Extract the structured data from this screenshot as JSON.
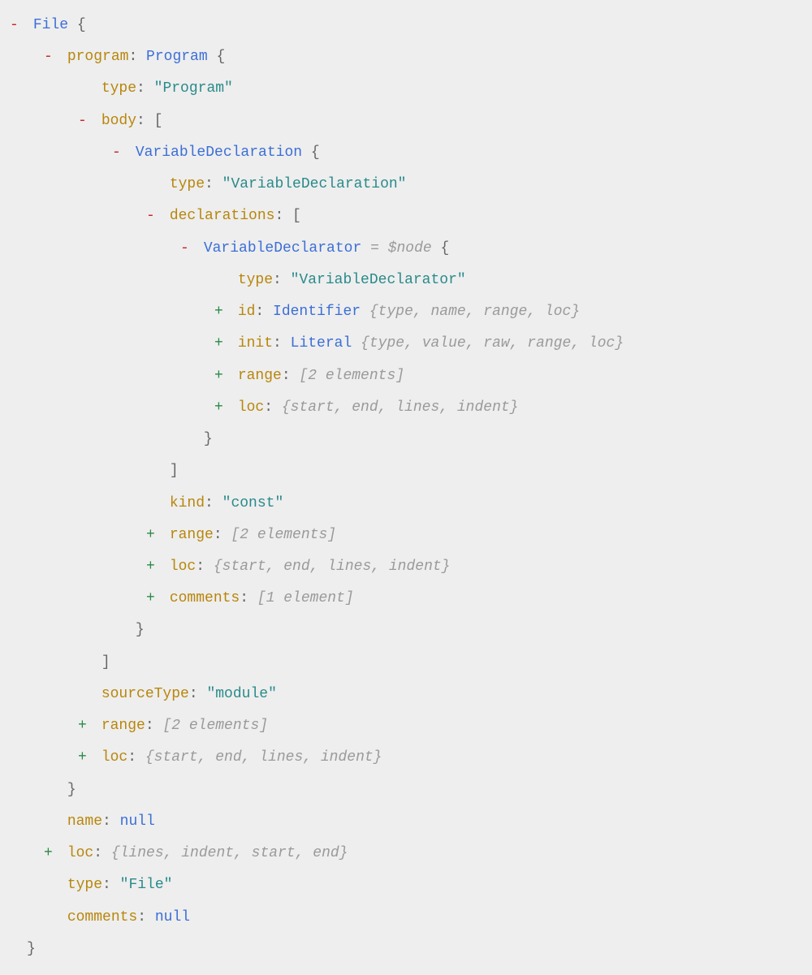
{
  "glyphs": {
    "open": "-",
    "closed": "+"
  },
  "root": {
    "toggle": "open",
    "type": "File",
    "children": [
      {
        "kind": "objprop",
        "toggle": "open",
        "key": "program",
        "type": "Program",
        "children": [
          {
            "kind": "kv",
            "key": "type",
            "valueType": "string",
            "value": "\"Program\""
          },
          {
            "kind": "arrprop",
            "toggle": "open",
            "key": "body",
            "children": [
              {
                "kind": "objitem",
                "toggle": "open",
                "type": "VariableDeclaration",
                "children": [
                  {
                    "kind": "kv",
                    "key": "type",
                    "valueType": "string",
                    "value": "\"VariableDeclaration\""
                  },
                  {
                    "kind": "arrprop",
                    "toggle": "open",
                    "key": "declarations",
                    "children": [
                      {
                        "kind": "objitem",
                        "toggle": "open",
                        "type": "VariableDeclarator",
                        "note": "= $node",
                        "children": [
                          {
                            "kind": "kv",
                            "key": "type",
                            "valueType": "string",
                            "value": "\"VariableDeclarator\""
                          },
                          {
                            "kind": "collapsedObj",
                            "key": "id",
                            "type": "Identifier",
                            "preview": "{type, name, range, loc}"
                          },
                          {
                            "kind": "collapsedObj",
                            "key": "init",
                            "type": "Literal",
                            "preview": "{type, value, raw, range, loc}"
                          },
                          {
                            "kind": "collapsedArr",
                            "key": "range",
                            "preview": "[2 elements]"
                          },
                          {
                            "kind": "collapsedPlain",
                            "key": "loc",
                            "preview": "{start, end, lines, indent}"
                          }
                        ]
                      }
                    ]
                  },
                  {
                    "kind": "kv",
                    "key": "kind",
                    "valueType": "string",
                    "value": "\"const\""
                  },
                  {
                    "kind": "collapsedArr",
                    "key": "range",
                    "preview": "[2 elements]"
                  },
                  {
                    "kind": "collapsedPlain",
                    "key": "loc",
                    "preview": "{start, end, lines, indent}"
                  },
                  {
                    "kind": "collapsedArr",
                    "key": "comments",
                    "preview": "[1 element]"
                  }
                ]
              }
            ]
          },
          {
            "kind": "kv",
            "key": "sourceType",
            "valueType": "string",
            "value": "\"module\""
          },
          {
            "kind": "collapsedArr",
            "key": "range",
            "preview": "[2 elements]"
          },
          {
            "kind": "collapsedPlain",
            "key": "loc",
            "preview": "{start, end, lines, indent}"
          }
        ]
      },
      {
        "kind": "kv",
        "key": "name",
        "valueType": "null",
        "value": "null"
      },
      {
        "kind": "collapsedPlain",
        "key": "loc",
        "preview": "{lines, indent, start, end}"
      },
      {
        "kind": "kv",
        "key": "type",
        "valueType": "string",
        "value": "\"File\""
      },
      {
        "kind": "kv",
        "key": "comments",
        "valueType": "null",
        "value": "null"
      }
    ]
  }
}
